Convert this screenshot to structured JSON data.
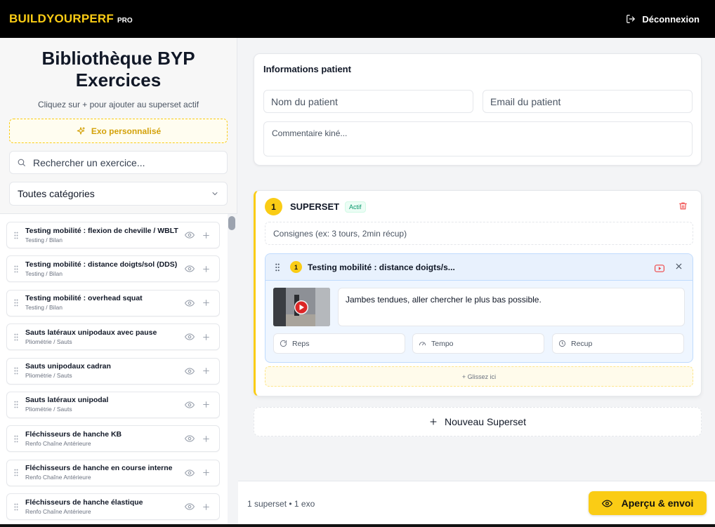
{
  "header": {
    "brand": "BUILDYOURPERF",
    "brand_suffix": "PRO",
    "logout_label": "Déconnexion"
  },
  "sidebar": {
    "title": "Bibliothèque BYP Exercices",
    "subtitle": "Cliquez sur + pour ajouter au superset actif",
    "custom_button": "Exo personnalisé",
    "search_placeholder": "Rechercher un exercice...",
    "category_select": "Toutes catégories",
    "exercises": [
      {
        "name": "Testing mobilité : flexion de cheville / WBLT",
        "category": "Testing / Bilan"
      },
      {
        "name": "Testing mobilité : distance doigts/sol (DDS)",
        "category": "Testing / Bilan"
      },
      {
        "name": "Testing mobilité : overhead squat",
        "category": "Testing / Bilan"
      },
      {
        "name": "Sauts latéraux unipodaux avec pause",
        "category": "Pliométrie / Sauts"
      },
      {
        "name": "Sauts unipodaux cadran",
        "category": "Pliométrie / Sauts"
      },
      {
        "name": "Sauts latéraux unipodal",
        "category": "Pliométrie / Sauts"
      },
      {
        "name": "Fléchisseurs de hanche KB",
        "category": "Renfo Chaîne Antérieure"
      },
      {
        "name": "Fléchisseurs de hanche en course interne",
        "category": "Renfo Chaîne Antérieure"
      },
      {
        "name": "Fléchisseurs de hanche élastique",
        "category": "Renfo Chaîne Antérieure"
      }
    ]
  },
  "patient": {
    "title": "Informations patient",
    "name_placeholder": "Nom du patient",
    "email_placeholder": "Email du patient",
    "comment_placeholder": "Commentaire kiné..."
  },
  "superset": {
    "number": "1",
    "title": "SUPERSET",
    "badge": "Actif",
    "instructions_placeholder": "Consignes (ex: 3 tours, 2min récup)",
    "exercise": {
      "number": "1",
      "name": "Testing mobilité : distance doigts/s...",
      "note": "Jambes tendues, aller chercher le plus bas possible.",
      "reps_placeholder": "Reps",
      "tempo_placeholder": "Tempo",
      "recup_placeholder": "Recup"
    },
    "drop_zone": "+ Glissez ici"
  },
  "new_superset_label": "Nouveau Superset",
  "footer": {
    "stats": "1 superset • 1 exo",
    "send_button": "Aperçu & envoi"
  },
  "colors": {
    "accent": "#facc15",
    "topbar": "#000000",
    "danger": "#ef4444",
    "success": "#059669"
  }
}
